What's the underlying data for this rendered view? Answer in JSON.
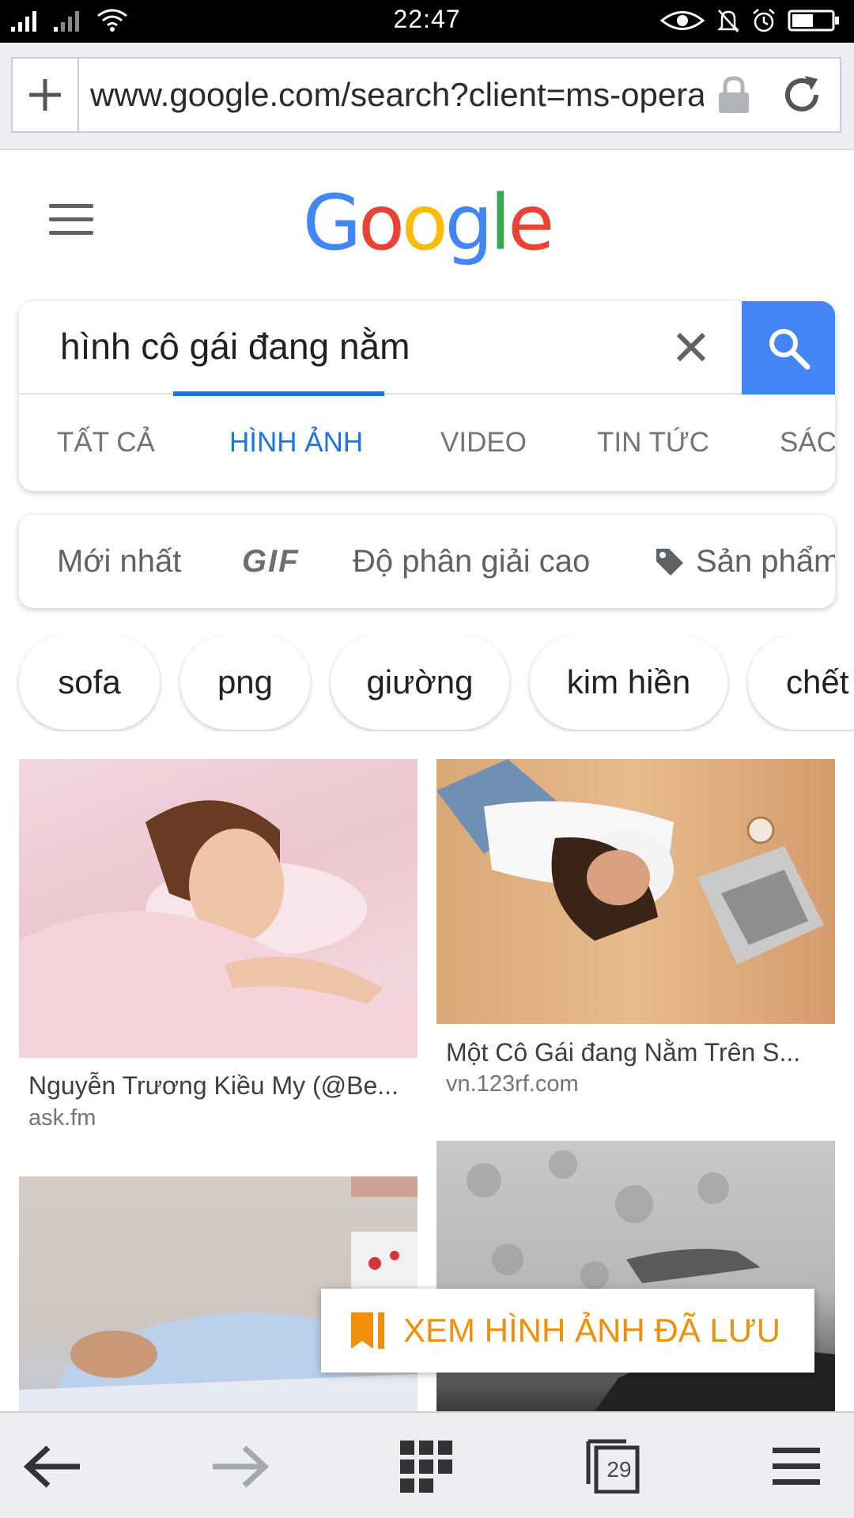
{
  "status_bar": {
    "time": "22:47"
  },
  "browser": {
    "url": "www.google.com/search?client=ms-opera",
    "open_tabs_count": "29"
  },
  "google": {
    "logo_letters": [
      {
        "ch": "G",
        "color": "#4285F4"
      },
      {
        "ch": "o",
        "color": "#EA4335"
      },
      {
        "ch": "o",
        "color": "#FBBC05"
      },
      {
        "ch": "g",
        "color": "#4285F4"
      },
      {
        "ch": "l",
        "color": "#34A853"
      },
      {
        "ch": "e",
        "color": "#EA4335"
      }
    ],
    "search_query": "hình cô gái đang nằm",
    "tabs": [
      {
        "label": "TẤT CẢ",
        "active": false
      },
      {
        "label": "HÌNH ẢNH",
        "active": true
      },
      {
        "label": "VIDEO",
        "active": false
      },
      {
        "label": "TIN TỨC",
        "active": false
      },
      {
        "label": "SÁCH",
        "active": false
      }
    ],
    "filters": {
      "newest": "Mới nhất",
      "gif": "GIF",
      "high_res": "Độ phân giải cao",
      "products": "Sản phẩm"
    },
    "chips": [
      "sofa",
      "png",
      "giường",
      "kim hiền",
      "chết"
    ],
    "results": [
      {
        "title": "Nguyễn Trương Kiều My (@Be...",
        "source": "ask.fm"
      },
      {
        "title": "Một Cô Gái đang Nằm Trên S...",
        "source": "vn.123rf.com"
      },
      {
        "title": "",
        "source": ""
      },
      {
        "title": "",
        "source": ""
      }
    ]
  },
  "saved_banner": {
    "label": "XEM HÌNH ẢNH ĐÃ LƯU"
  },
  "colors": {
    "accent_blue": "#1a73e8",
    "search_button": "#4285f4",
    "saved_orange": "#f0900a"
  }
}
